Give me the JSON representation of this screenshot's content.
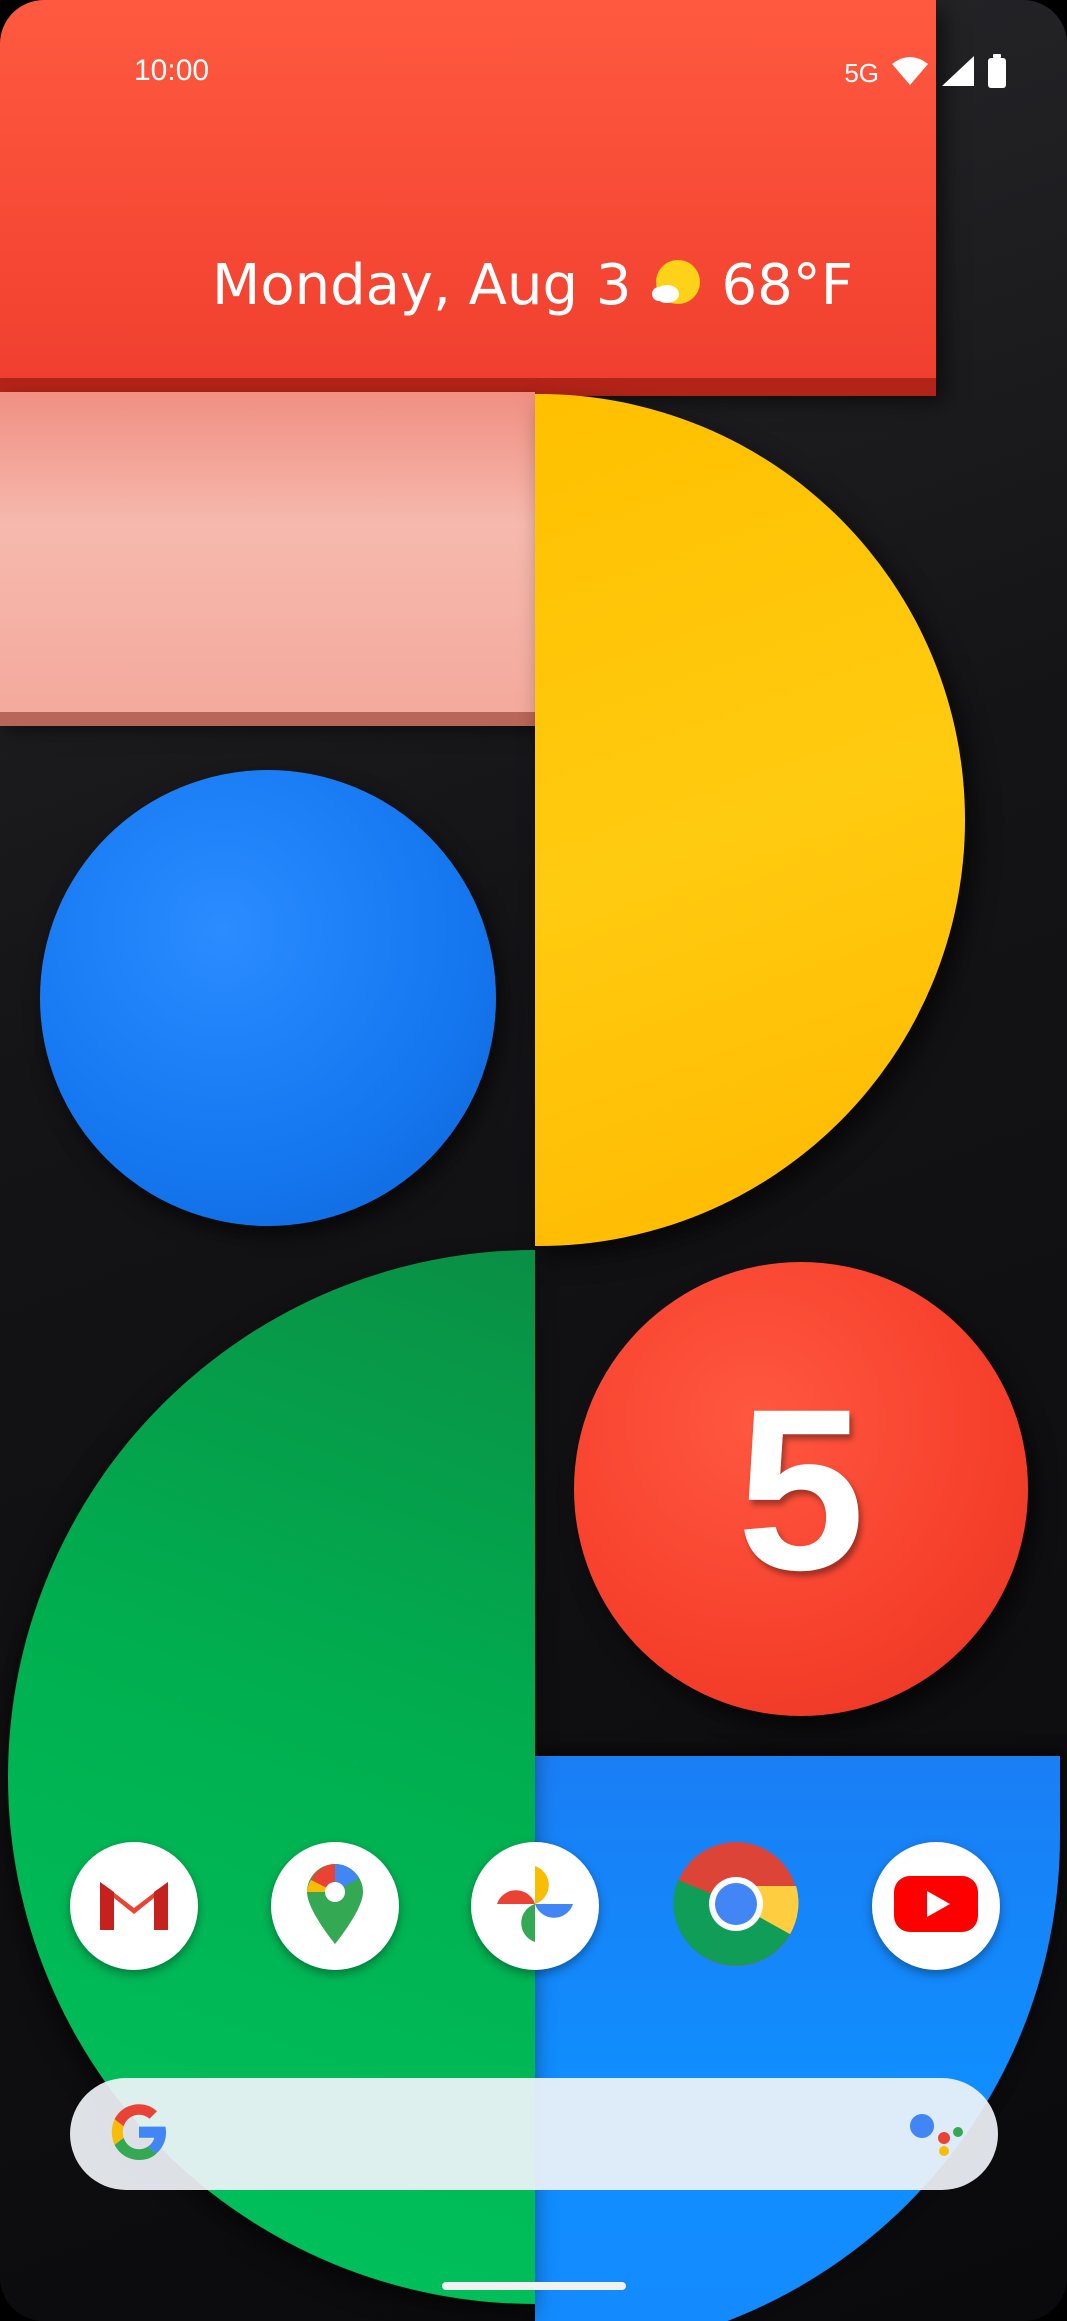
{
  "status_bar": {
    "time": "10:00",
    "network": "5G",
    "icons": [
      "wifi-icon",
      "cell-signal-icon",
      "battery-icon"
    ]
  },
  "at_a_glance": {
    "date": "Monday, Aug 3",
    "weather_icon": "partly-sunny-icon",
    "temperature": "68°F"
  },
  "wallpaper": {
    "badge_number": "5",
    "colors": {
      "red": "#f4442f",
      "pink": "#f6b3a7",
      "yellow": "#ffc20e",
      "blue": "#1a80f5",
      "green": "#00b552"
    }
  },
  "dock": {
    "apps": [
      {
        "name": "Gmail",
        "icon": "gmail-icon"
      },
      {
        "name": "Maps",
        "icon": "maps-icon"
      },
      {
        "name": "Photos",
        "icon": "photos-icon"
      },
      {
        "name": "Chrome",
        "icon": "chrome-icon"
      },
      {
        "name": "YouTube",
        "icon": "youtube-icon"
      }
    ]
  },
  "search_bar": {
    "left_icon": "google-g-icon",
    "right_icon": "google-assistant-icon"
  }
}
